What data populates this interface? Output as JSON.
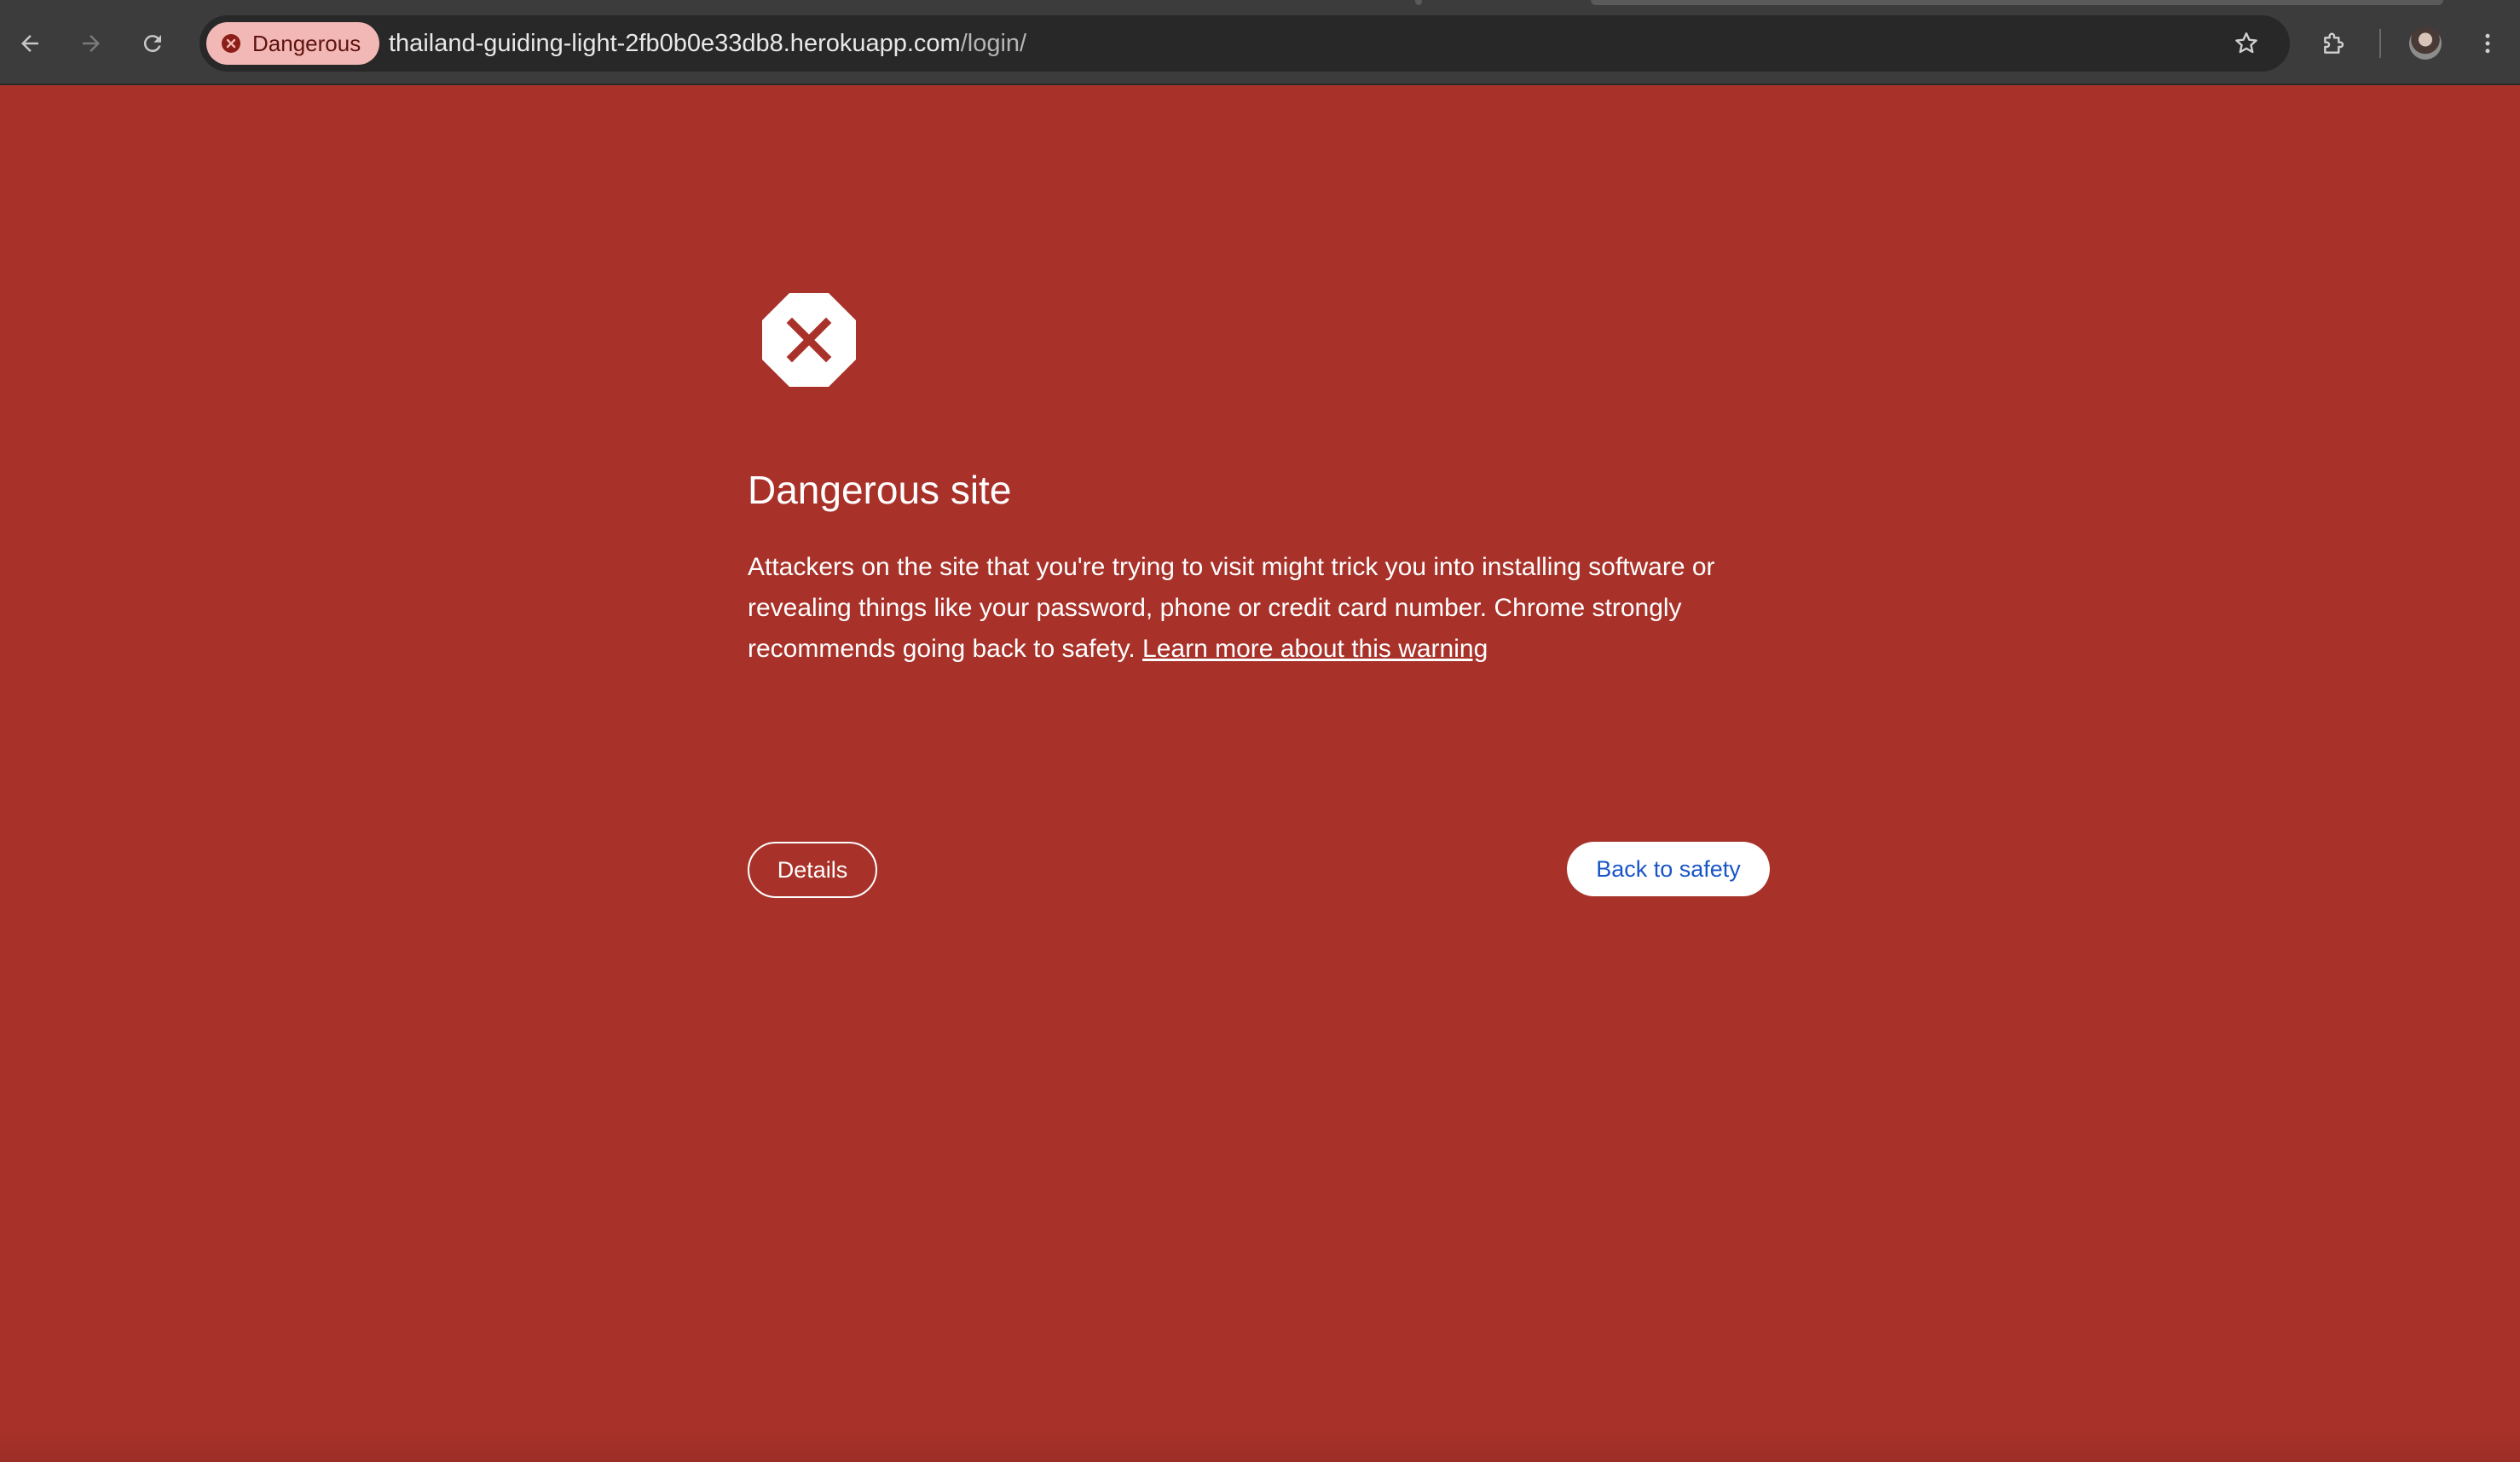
{
  "browser": {
    "security_chip_label": "Dangerous",
    "url_host": "thailand-guiding-light-2fb0b0e33db8.herokuapp.com",
    "url_path": "/login/",
    "toolbar_bg": "#3c3c3c",
    "omnibox_bg": "#282828",
    "chip_bg": "#f2b8b5"
  },
  "interstitial": {
    "title": "Dangerous site",
    "message_text": "Attackers on the site that you're trying to visit might trick you into installing software or revealing things like your password, phone or credit card number. Chrome strongly recommends going back to safety.",
    "learn_more_link": "Learn more about this warning",
    "details_button": "Details",
    "back_button": "Back to safety",
    "background_color": "#a8322a",
    "primary_button_text_color": "#1a55c7"
  }
}
